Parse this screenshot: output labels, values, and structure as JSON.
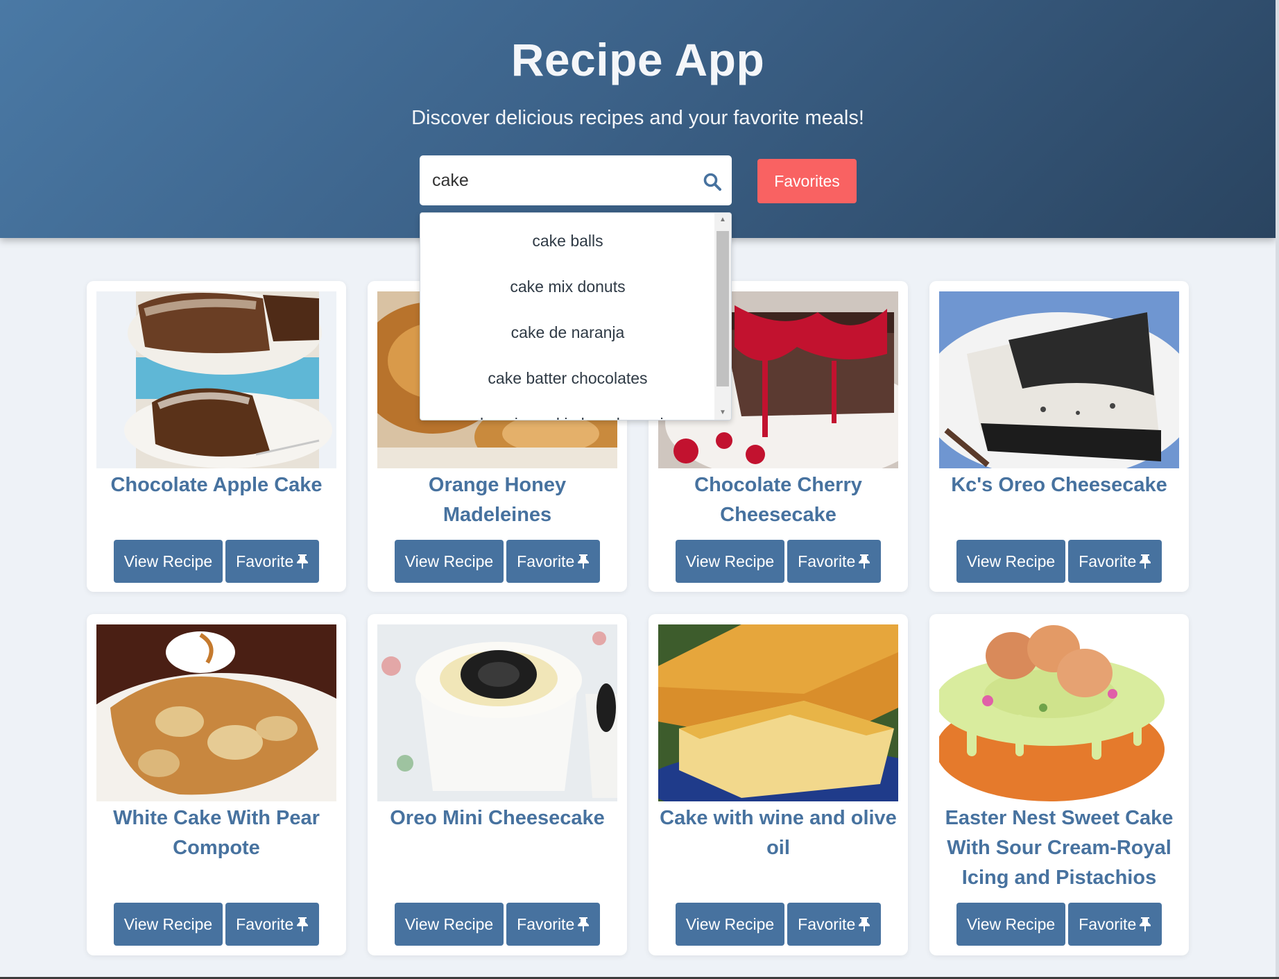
{
  "header": {
    "title": "Recipe App",
    "subtitle": "Discover delicious recipes and your favorite meals!",
    "favorites_label": "Favorites"
  },
  "search": {
    "value": "cake",
    "suggestions": [
      "cake balls",
      "cake mix donuts",
      "cake de naranja",
      "cake batter chocolates",
      "cake mix cookie bars brownie"
    ]
  },
  "recipes": [
    {
      "title": "Chocolate Apple Cake",
      "view_label": "View Recipe",
      "favorite_label": "Favorite"
    },
    {
      "title": "Orange Honey Madeleines",
      "view_label": "View Recipe",
      "favorite_label": "Favorite"
    },
    {
      "title": "Chocolate Cherry Cheesecake",
      "view_label": "View Recipe",
      "favorite_label": "Favorite"
    },
    {
      "title": "Kc's Oreo Cheesecake",
      "view_label": "View Recipe",
      "favorite_label": "Favorite"
    },
    {
      "title": "White Cake With Pear Compote",
      "view_label": "View Recipe",
      "favorite_label": "Favorite"
    },
    {
      "title": "Oreo Mini Cheesecake",
      "view_label": "View Recipe",
      "favorite_label": "Favorite"
    },
    {
      "title": "Cake with wine and olive oil",
      "view_label": "View Recipe",
      "favorite_label": "Favorite"
    },
    {
      "title": "Easter Nest Sweet Cake With Sour Cream-Royal Icing and Pistachios",
      "view_label": "View Recipe",
      "favorite_label": "Favorite"
    }
  ],
  "colors": {
    "header_start": "#4a79a5",
    "header_end": "#2a4460",
    "accent": "#47729f",
    "favorites_button": "#f96262",
    "page_background": "#eef2f7"
  },
  "icons": {
    "search": "search-icon",
    "pin": "pin-icon"
  }
}
